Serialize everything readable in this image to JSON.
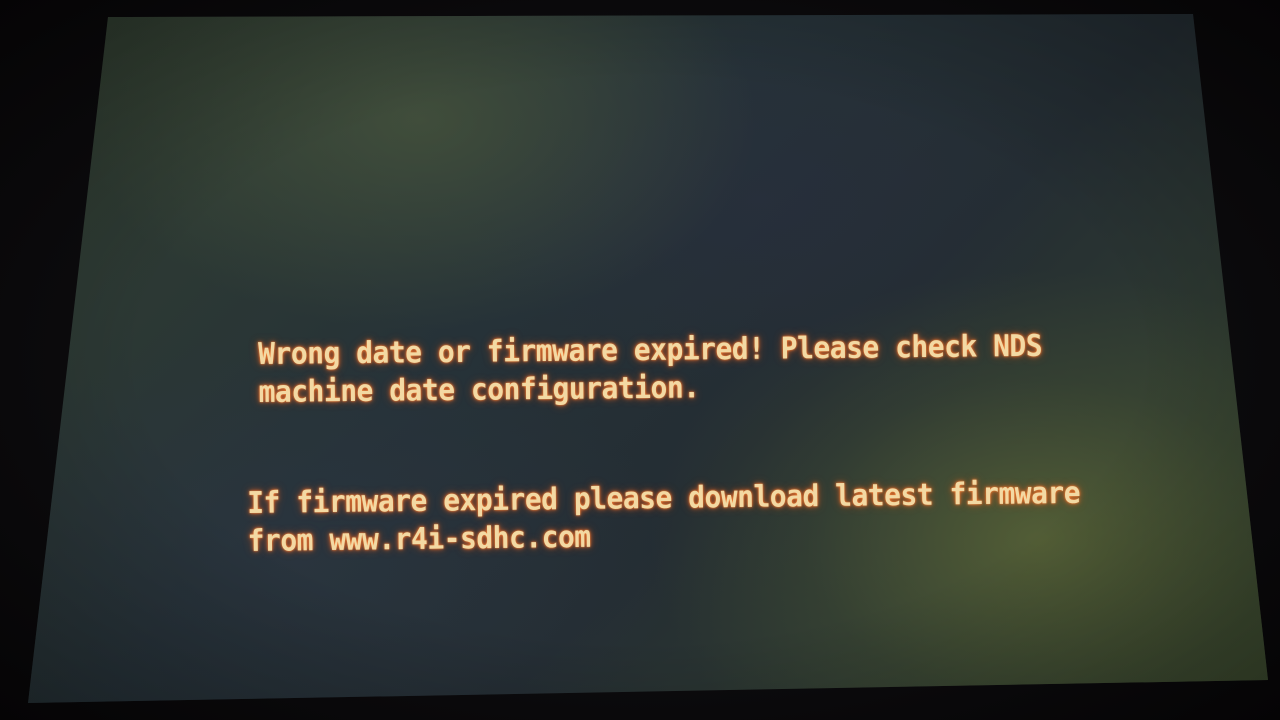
{
  "error_screen": {
    "message_1": {
      "line_1": "Wrong date or firmware expired! Please check NDS",
      "line_2": "machine date configuration."
    },
    "message_2": {
      "line_1": "If firmware expired please download latest firmware",
      "line_2": "from www.r4i-sdhc.com"
    }
  },
  "colors": {
    "text": "#f3d9a3",
    "glow": "#ff8a3a",
    "screen_background": "#263238",
    "bezel": "#0b0a0c"
  }
}
